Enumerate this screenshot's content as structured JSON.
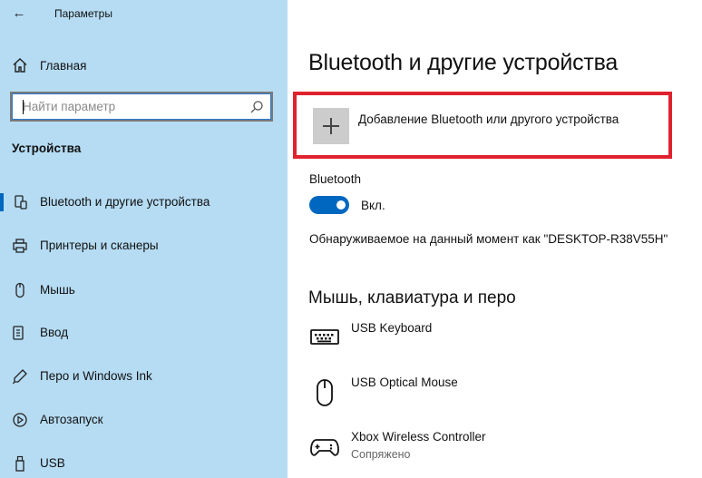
{
  "window": {
    "app_title": "Параметры"
  },
  "sidebar": {
    "home_label": "Главная",
    "search": {
      "placeholder": "Найти параметр"
    },
    "section_title": "Устройства",
    "items": [
      {
        "label": "Bluetooth и другие устройства",
        "icon": "bluetooth-devices-icon",
        "active": true
      },
      {
        "label": "Принтеры и сканеры",
        "icon": "printer-icon",
        "active": false
      },
      {
        "label": "Мышь",
        "icon": "mouse-icon",
        "active": false
      },
      {
        "label": "Ввод",
        "icon": "keyboard-icon",
        "active": false
      },
      {
        "label": "Перо и Windows Ink",
        "icon": "pen-icon",
        "active": false
      },
      {
        "label": "Автозапуск",
        "icon": "autoplay-icon",
        "active": false
      },
      {
        "label": "USB",
        "icon": "usb-icon",
        "active": false
      }
    ]
  },
  "main": {
    "page_title": "Bluetooth и другие устройства",
    "add_device_label": "Добавление Bluetooth или другого устройства",
    "bluetooth": {
      "label": "Bluetooth",
      "toggle_state": "Вкл.",
      "on": true
    },
    "discoverable_text": "Обнаруживаемое на данный момент как \"DESKTOP-R38V55H\"",
    "section_title": "Мышь, клавиатура и перо",
    "devices": [
      {
        "name": "USB Keyboard",
        "status": "",
        "icon": "keyboard-icon"
      },
      {
        "name": "USB Optical Mouse",
        "status": "",
        "icon": "mouse-icon"
      },
      {
        "name": "Xbox Wireless Controller",
        "status": "Сопряжено",
        "icon": "gamepad-icon"
      }
    ]
  },
  "colors": {
    "sidebar_bg": "#b5dcf3",
    "accent": "#0067c0",
    "highlight_border": "#e0222e"
  }
}
